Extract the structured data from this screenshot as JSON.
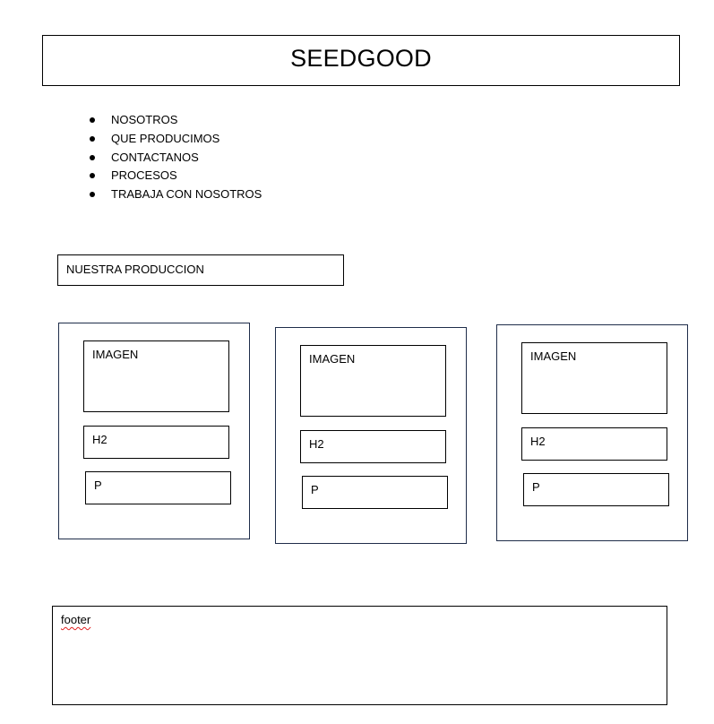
{
  "header": {
    "title": "SEEDGOOD"
  },
  "nav": {
    "items": [
      {
        "label": "NOSOTROS"
      },
      {
        "label": "QUE PRODUCIMOS"
      },
      {
        "label": "CONTACTANOS"
      },
      {
        "label": "PROCESOS"
      },
      {
        "label": "TRABAJA CON NOSOTROS"
      }
    ]
  },
  "section": {
    "title": "NUESTRA PRODUCCION"
  },
  "cards": [
    {
      "image_label": "IMAGEN",
      "heading_label": "H2",
      "paragraph_label": "P"
    },
    {
      "image_label": "IMAGEN",
      "heading_label": "H2",
      "paragraph_label": "P"
    },
    {
      "image_label": "IMAGEN",
      "heading_label": "H2",
      "paragraph_label": "P"
    }
  ],
  "footer": {
    "label": "footer"
  },
  "colors": {
    "border": "#000000",
    "card_border": "#1f2d4a",
    "spellcheck_underline": "#e02020"
  }
}
